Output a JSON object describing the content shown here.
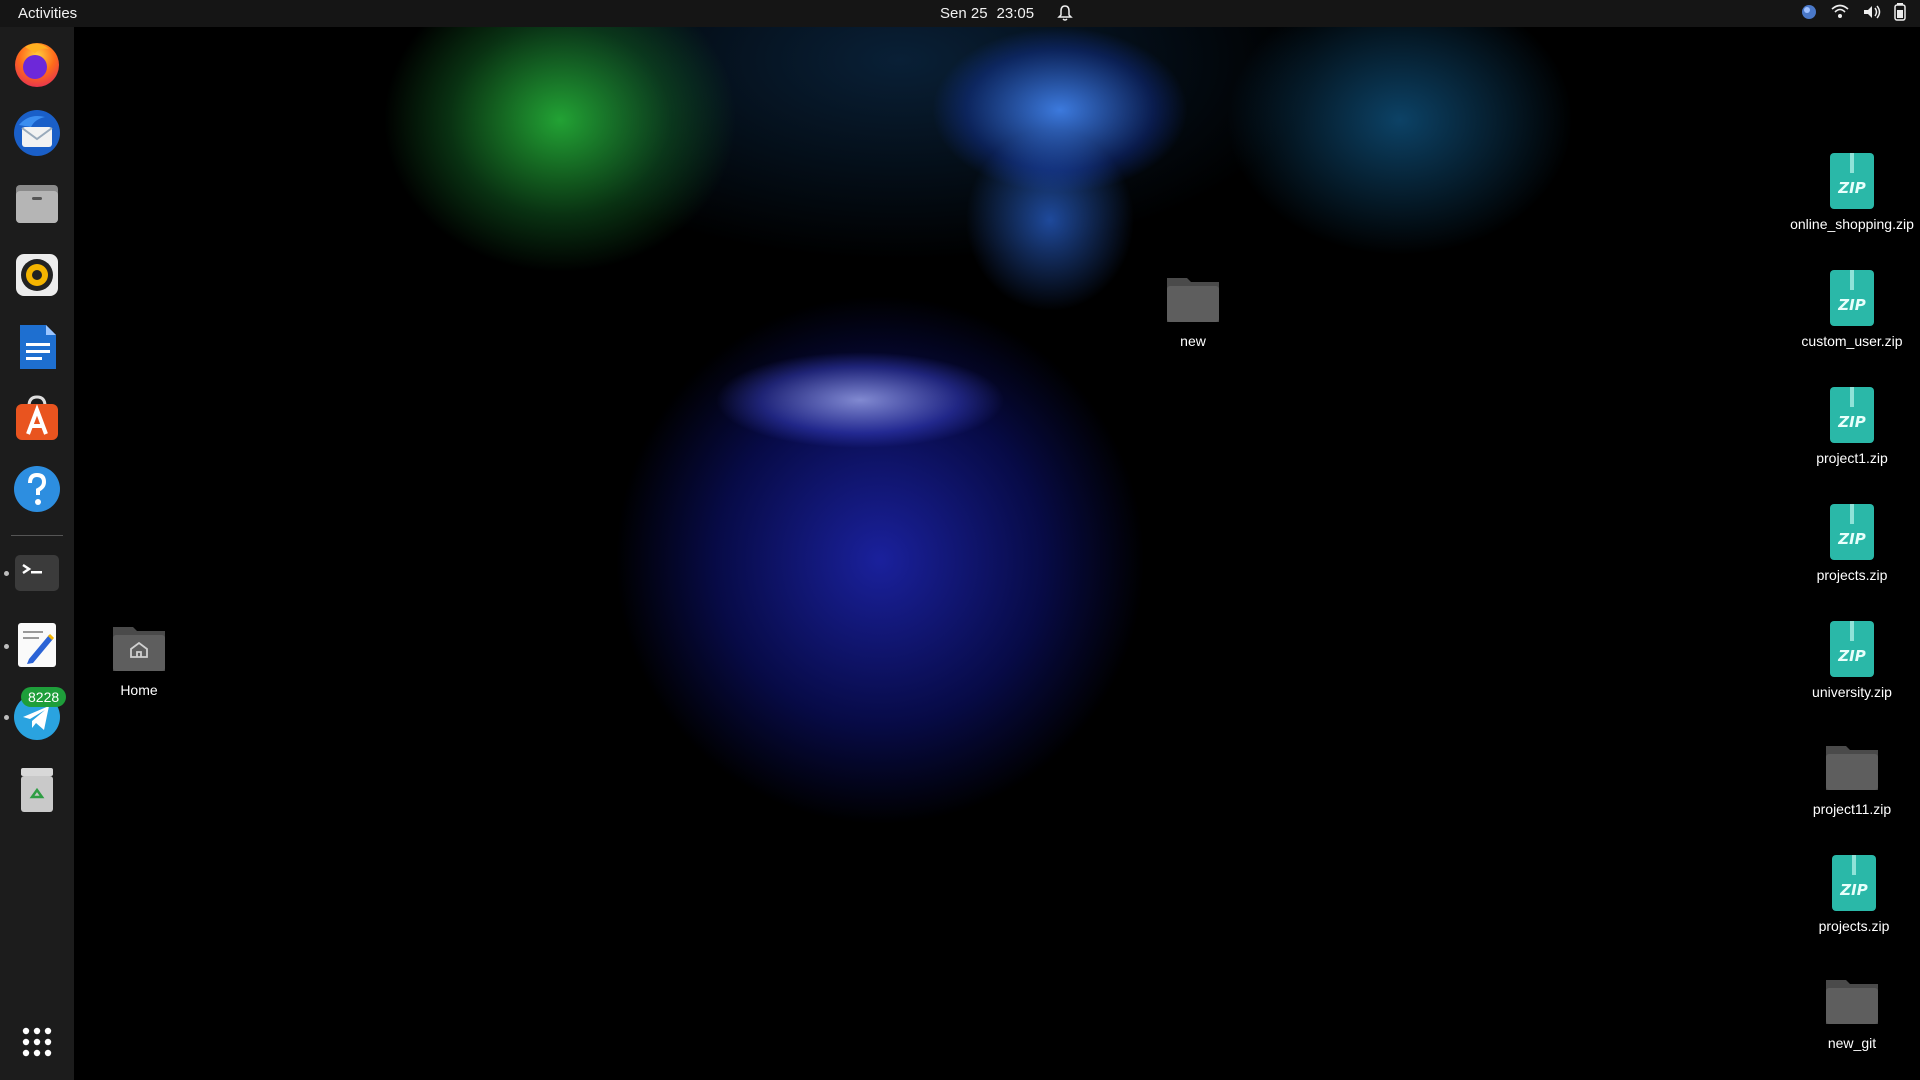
{
  "topbar": {
    "activities_label": "Activities",
    "date": "Sen 25",
    "time": "23:05",
    "icons": [
      "bell-icon",
      "vpn-globe-icon",
      "wifi-icon",
      "volume-icon",
      "battery-icon"
    ]
  },
  "dock": {
    "apps": [
      {
        "name": "Firefox",
        "icon": "firefox-icon"
      },
      {
        "name": "Thunderbird",
        "icon": "thunderbird-icon"
      },
      {
        "name": "Files",
        "icon": "files-icon"
      },
      {
        "name": "Rhythmbox",
        "icon": "rhythmbox-icon"
      },
      {
        "name": "LibreOffice Writer",
        "icon": "writer-icon"
      },
      {
        "name": "Ubuntu Software",
        "icon": "software-center-icon"
      },
      {
        "name": "Help",
        "icon": "help-icon"
      },
      {
        "name": "Terminal",
        "icon": "terminal-icon"
      },
      {
        "name": "Text Editor",
        "icon": "text-editor-icon"
      },
      {
        "name": "Telegram",
        "icon": "telegram-icon",
        "badge": "8228"
      },
      {
        "name": "Trash",
        "icon": "trash-icon"
      },
      {
        "name": "Show Applications",
        "icon": "app-grid-icon"
      }
    ]
  },
  "desktop": {
    "home": {
      "label": "Home",
      "icon": "home-folder-icon"
    },
    "new_folder": {
      "label": "new",
      "icon": "folder-icon"
    },
    "right_column": [
      {
        "label": "online_shopping.zip",
        "icon": "zip-icon"
      },
      {
        "label": "custom_user.zip",
        "icon": "zip-icon"
      },
      {
        "label": "project1.zip",
        "icon": "zip-icon"
      },
      {
        "label": "projects.zip",
        "icon": "zip-icon"
      },
      {
        "label": "university.zip",
        "icon": "zip-icon"
      },
      {
        "label": "project11.zip",
        "icon": "folder-icon"
      },
      {
        "label": "projects.zip",
        "icon": "zip-icon"
      },
      {
        "label": "new_git",
        "icon": "folder-icon"
      }
    ]
  },
  "colors": {
    "topbar_bg": "#151515",
    "dock_bg": "#1c1c1c",
    "zip_teal": "#2ab8a8",
    "folder_gray": "#5a5a5a",
    "badge_green": "#1e9e3a"
  }
}
